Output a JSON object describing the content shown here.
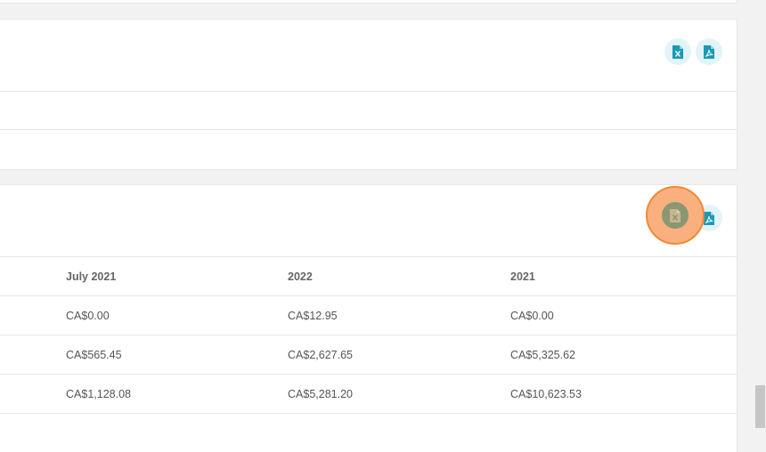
{
  "colors": {
    "accent": "#1a9ab5",
    "icon_bg": "#e2f4f8",
    "highlight_ring": "#f08a37",
    "highlight_fill": "#f9b07e"
  },
  "icons": [
    "excel-export-icon",
    "pdf-export-icon"
  ],
  "table": {
    "headers": [
      "July 2021",
      "2022",
      "2021"
    ],
    "rows": [
      [
        "CA$0.00",
        "CA$12.95",
        "CA$0.00"
      ],
      [
        "CA$565.45",
        "CA$2,627.65",
        "CA$5,325.62"
      ],
      [
        "CA$1,128.08",
        "CA$5,281.20",
        "CA$10,623.53"
      ]
    ]
  }
}
